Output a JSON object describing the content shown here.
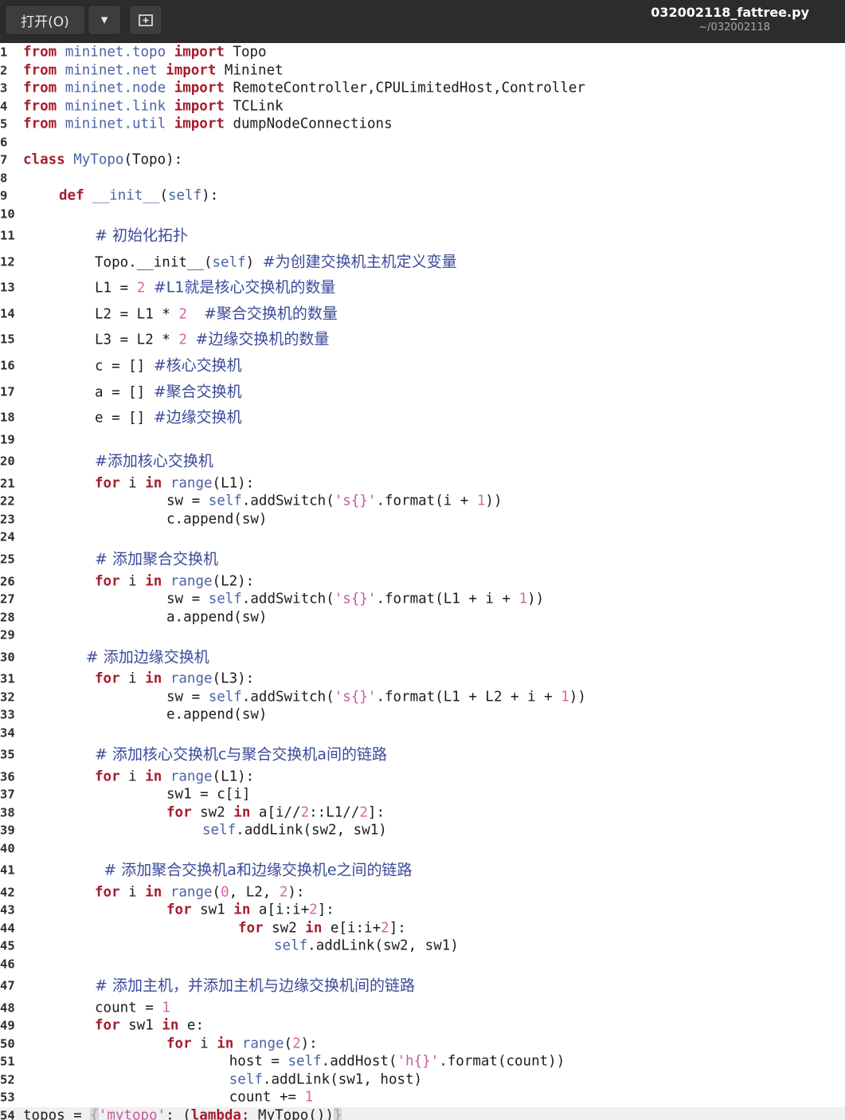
{
  "toolbar": {
    "open_label": "打开(O)",
    "dropdown_glyph": "▾",
    "newtab_glyph": "⊞"
  },
  "header": {
    "filename": "032002118_fattree.py",
    "path": "~/032002118"
  },
  "code": {
    "lines": [
      {
        "n": "1",
        "indent": 0,
        "parts": [
          [
            "kw",
            "from"
          ],
          [
            "t",
            " "
          ],
          [
            "mod",
            "mininet.topo"
          ],
          [
            "t",
            " "
          ],
          [
            "kw",
            "import"
          ],
          [
            "t",
            " Topo"
          ]
        ]
      },
      {
        "n": "2",
        "indent": 0,
        "parts": [
          [
            "kw",
            "from"
          ],
          [
            "t",
            " "
          ],
          [
            "mod",
            "mininet.net"
          ],
          [
            "t",
            " "
          ],
          [
            "kw",
            "import"
          ],
          [
            "t",
            " Mininet"
          ]
        ]
      },
      {
        "n": "3",
        "indent": 0,
        "parts": [
          [
            "kw",
            "from"
          ],
          [
            "t",
            " "
          ],
          [
            "mod",
            "mininet.node"
          ],
          [
            "t",
            " "
          ],
          [
            "kw",
            "import"
          ],
          [
            "t",
            " RemoteController,CPULimitedHost,Controller"
          ]
        ]
      },
      {
        "n": "4",
        "indent": 0,
        "parts": [
          [
            "kw",
            "from"
          ],
          [
            "t",
            " "
          ],
          [
            "mod",
            "mininet.link"
          ],
          [
            "t",
            " "
          ],
          [
            "kw",
            "import"
          ],
          [
            "t",
            " TCLink"
          ]
        ]
      },
      {
        "n": "5",
        "indent": 0,
        "parts": [
          [
            "kw",
            "from"
          ],
          [
            "t",
            " "
          ],
          [
            "mod",
            "mininet.util"
          ],
          [
            "t",
            " "
          ],
          [
            "kw",
            "import"
          ],
          [
            "t",
            " dumpNodeConnections"
          ]
        ]
      },
      {
        "n": "6",
        "indent": 0,
        "parts": []
      },
      {
        "n": "7",
        "indent": 0,
        "parts": [
          [
            "kw",
            "class"
          ],
          [
            "t",
            " "
          ],
          [
            "fn",
            "MyTopo"
          ],
          [
            "t",
            "(Topo):"
          ]
        ]
      },
      {
        "n": "8",
        "indent": 0,
        "parts": []
      },
      {
        "n": "9",
        "indent": 4,
        "parts": [
          [
            "kw",
            "def"
          ],
          [
            "t",
            " "
          ],
          [
            "fn",
            "__init__"
          ],
          [
            "t",
            "("
          ],
          [
            "slf",
            "self"
          ],
          [
            "t",
            "):"
          ]
        ]
      },
      {
        "n": "10",
        "indent": 0,
        "parts": []
      },
      {
        "n": "11",
        "indent": 8,
        "parts": [
          [
            "cm",
            "# 初始化拓扑"
          ]
        ]
      },
      {
        "n": "12",
        "indent": 8,
        "parts": [
          [
            "t",
            "Topo.__init__("
          ],
          [
            "slf",
            "self"
          ],
          [
            "t",
            ") "
          ],
          [
            "cm",
            "#为创建交换机主机定义变量"
          ]
        ]
      },
      {
        "n": "13",
        "indent": 8,
        "parts": [
          [
            "t",
            "L1 = "
          ],
          [
            "num",
            "2"
          ],
          [
            "t",
            " "
          ],
          [
            "cm",
            "#L1就是核心交换机的数量"
          ]
        ]
      },
      {
        "n": "14",
        "indent": 8,
        "parts": [
          [
            "t",
            "L2 = L1 * "
          ],
          [
            "num",
            "2"
          ],
          [
            "t",
            "  "
          ],
          [
            "cm",
            "#聚合交换机的数量"
          ]
        ]
      },
      {
        "n": "15",
        "indent": 8,
        "parts": [
          [
            "t",
            "L3 = L2 * "
          ],
          [
            "num",
            "2"
          ],
          [
            "t",
            " "
          ],
          [
            "cm",
            "#边缘交换机的数量"
          ]
        ]
      },
      {
        "n": "16",
        "indent": 8,
        "parts": [
          [
            "t",
            "c = [] "
          ],
          [
            "cm",
            "#核心交换机"
          ]
        ]
      },
      {
        "n": "17",
        "indent": 8,
        "parts": [
          [
            "t",
            "a = [] "
          ],
          [
            "cm",
            "#聚合交换机"
          ]
        ]
      },
      {
        "n": "18",
        "indent": 8,
        "parts": [
          [
            "t",
            "e = [] "
          ],
          [
            "cm",
            "#边缘交换机"
          ]
        ]
      },
      {
        "n": "19",
        "indent": 0,
        "parts": []
      },
      {
        "n": "20",
        "indent": 8,
        "parts": [
          [
            "cm",
            "#添加核心交换机"
          ]
        ]
      },
      {
        "n": "21",
        "indent": 8,
        "parts": [
          [
            "kw",
            "for"
          ],
          [
            "t",
            " i "
          ],
          [
            "kw",
            "in"
          ],
          [
            "t",
            " "
          ],
          [
            "bi",
            "range"
          ],
          [
            "t",
            "(L1):"
          ]
        ]
      },
      {
        "n": "22",
        "indent": 16,
        "parts": [
          [
            "t",
            "sw = "
          ],
          [
            "slf",
            "self"
          ],
          [
            "t",
            ".addSwitch("
          ],
          [
            "str",
            "'s{}'"
          ],
          [
            "t",
            ".format(i + "
          ],
          [
            "num",
            "1"
          ],
          [
            "t",
            "))"
          ]
        ]
      },
      {
        "n": "23",
        "indent": 16,
        "parts": [
          [
            "t",
            "c.append(sw)"
          ]
        ]
      },
      {
        "n": "24",
        "indent": 0,
        "parts": []
      },
      {
        "n": "25",
        "indent": 8,
        "parts": [
          [
            "cm",
            "# 添加聚合交换机"
          ]
        ]
      },
      {
        "n": "26",
        "indent": 8,
        "parts": [
          [
            "kw",
            "for"
          ],
          [
            "t",
            " i "
          ],
          [
            "kw",
            "in"
          ],
          [
            "t",
            " "
          ],
          [
            "bi",
            "range"
          ],
          [
            "t",
            "(L2):"
          ]
        ]
      },
      {
        "n": "27",
        "indent": 16,
        "parts": [
          [
            "t",
            "sw = "
          ],
          [
            "slf",
            "self"
          ],
          [
            "t",
            ".addSwitch("
          ],
          [
            "str",
            "'s{}'"
          ],
          [
            "t",
            ".format(L1 + i + "
          ],
          [
            "num",
            "1"
          ],
          [
            "t",
            "))"
          ]
        ]
      },
      {
        "n": "28",
        "indent": 16,
        "parts": [
          [
            "t",
            "a.append(sw)"
          ]
        ]
      },
      {
        "n": "29",
        "indent": 0,
        "parts": []
      },
      {
        "n": "30",
        "indent": 7,
        "parts": [
          [
            "cm",
            "# 添加边缘交换机"
          ]
        ]
      },
      {
        "n": "31",
        "indent": 8,
        "parts": [
          [
            "kw",
            "for"
          ],
          [
            "t",
            " i "
          ],
          [
            "kw",
            "in"
          ],
          [
            "t",
            " "
          ],
          [
            "bi",
            "range"
          ],
          [
            "t",
            "(L3):"
          ]
        ]
      },
      {
        "n": "32",
        "indent": 16,
        "parts": [
          [
            "t",
            "sw = "
          ],
          [
            "slf",
            "self"
          ],
          [
            "t",
            ".addSwitch("
          ],
          [
            "str",
            "'s{}'"
          ],
          [
            "t",
            ".format(L1 + L2 + i + "
          ],
          [
            "num",
            "1"
          ],
          [
            "t",
            "))"
          ]
        ]
      },
      {
        "n": "33",
        "indent": 16,
        "parts": [
          [
            "t",
            "e.append(sw)"
          ]
        ]
      },
      {
        "n": "34",
        "indent": 0,
        "parts": []
      },
      {
        "n": "35",
        "indent": 8,
        "parts": [
          [
            "cm",
            "# 添加核心交换机c与聚合交换机a间的链路"
          ]
        ]
      },
      {
        "n": "36",
        "indent": 8,
        "parts": [
          [
            "kw",
            "for"
          ],
          [
            "t",
            " i "
          ],
          [
            "kw",
            "in"
          ],
          [
            "t",
            " "
          ],
          [
            "bi",
            "range"
          ],
          [
            "t",
            "(L1):"
          ]
        ]
      },
      {
        "n": "37",
        "indent": 16,
        "parts": [
          [
            "t",
            "sw1 = c[i]"
          ]
        ]
      },
      {
        "n": "38",
        "indent": 16,
        "parts": [
          [
            "kw",
            "for"
          ],
          [
            "t",
            " sw2 "
          ],
          [
            "kw",
            "in"
          ],
          [
            "t",
            " a[i//"
          ],
          [
            "num",
            "2"
          ],
          [
            "t",
            "::L1//"
          ],
          [
            "num",
            "2"
          ],
          [
            "t",
            "]:"
          ]
        ]
      },
      {
        "n": "39",
        "indent": 20,
        "parts": [
          [
            "slf",
            "self"
          ],
          [
            "t",
            ".addLink(sw2, sw1)"
          ]
        ]
      },
      {
        "n": "40",
        "indent": 0,
        "parts": []
      },
      {
        "n": "41",
        "indent": 9,
        "parts": [
          [
            "cm",
            "# 添加聚合交换机a和边缘交换机e之间的链路"
          ]
        ]
      },
      {
        "n": "42",
        "indent": 8,
        "parts": [
          [
            "kw",
            "for"
          ],
          [
            "t",
            " i "
          ],
          [
            "kw",
            "in"
          ],
          [
            "t",
            " "
          ],
          [
            "bi",
            "range"
          ],
          [
            "t",
            "("
          ],
          [
            "num",
            "0"
          ],
          [
            "t",
            ", L2, "
          ],
          [
            "num",
            "2"
          ],
          [
            "t",
            "):"
          ]
        ]
      },
      {
        "n": "43",
        "indent": 16,
        "parts": [
          [
            "kw",
            "for"
          ],
          [
            "t",
            " sw1 "
          ],
          [
            "kw",
            "in"
          ],
          [
            "t",
            " a[i:i+"
          ],
          [
            "num",
            "2"
          ],
          [
            "t",
            "]:"
          ]
        ]
      },
      {
        "n": "44",
        "indent": 24,
        "parts": [
          [
            "kw",
            "for"
          ],
          [
            "t",
            " sw2 "
          ],
          [
            "kw",
            "in"
          ],
          [
            "t",
            " e[i:i+"
          ],
          [
            "num",
            "2"
          ],
          [
            "t",
            "]:"
          ]
        ]
      },
      {
        "n": "45",
        "indent": 28,
        "parts": [
          [
            "slf",
            "self"
          ],
          [
            "t",
            ".addLink(sw2, sw1)"
          ]
        ]
      },
      {
        "n": "46",
        "indent": 0,
        "parts": []
      },
      {
        "n": "47",
        "indent": 8,
        "parts": [
          [
            "cm",
            "# 添加主机，并添加主机与边缘交换机间的链路"
          ]
        ]
      },
      {
        "n": "48",
        "indent": 8,
        "parts": [
          [
            "t",
            "count = "
          ],
          [
            "num",
            "1"
          ]
        ]
      },
      {
        "n": "49",
        "indent": 8,
        "parts": [
          [
            "kw",
            "for"
          ],
          [
            "t",
            " sw1 "
          ],
          [
            "kw",
            "in"
          ],
          [
            "t",
            " e:"
          ]
        ]
      },
      {
        "n": "50",
        "indent": 16,
        "parts": [
          [
            "kw",
            "for"
          ],
          [
            "t",
            " i "
          ],
          [
            "kw",
            "in"
          ],
          [
            "t",
            " "
          ],
          [
            "bi",
            "range"
          ],
          [
            "t",
            "("
          ],
          [
            "num",
            "2"
          ],
          [
            "t",
            "):"
          ]
        ]
      },
      {
        "n": "51",
        "indent": 23,
        "parts": [
          [
            "t",
            "host = "
          ],
          [
            "slf",
            "self"
          ],
          [
            "t",
            ".addHost("
          ],
          [
            "str",
            "'h{}'"
          ],
          [
            "t",
            ".format(count))"
          ]
        ]
      },
      {
        "n": "52",
        "indent": 23,
        "parts": [
          [
            "slf",
            "self"
          ],
          [
            "t",
            ".addLink(sw1, host)"
          ]
        ]
      },
      {
        "n": "53",
        "indent": 23,
        "parts": [
          [
            "t",
            "count += "
          ],
          [
            "num",
            "1"
          ]
        ]
      },
      {
        "n": "54",
        "indent": 0,
        "current": true,
        "parts": [
          [
            "t",
            "topos = "
          ],
          [
            "brk",
            "{"
          ],
          [
            "str",
            "'mytopo'"
          ],
          [
            "t",
            ": ("
          ],
          [
            "kw",
            "lambda"
          ],
          [
            "t",
            ": MyTopo())"
          ],
          [
            "brk",
            "}"
          ]
        ]
      }
    ]
  }
}
